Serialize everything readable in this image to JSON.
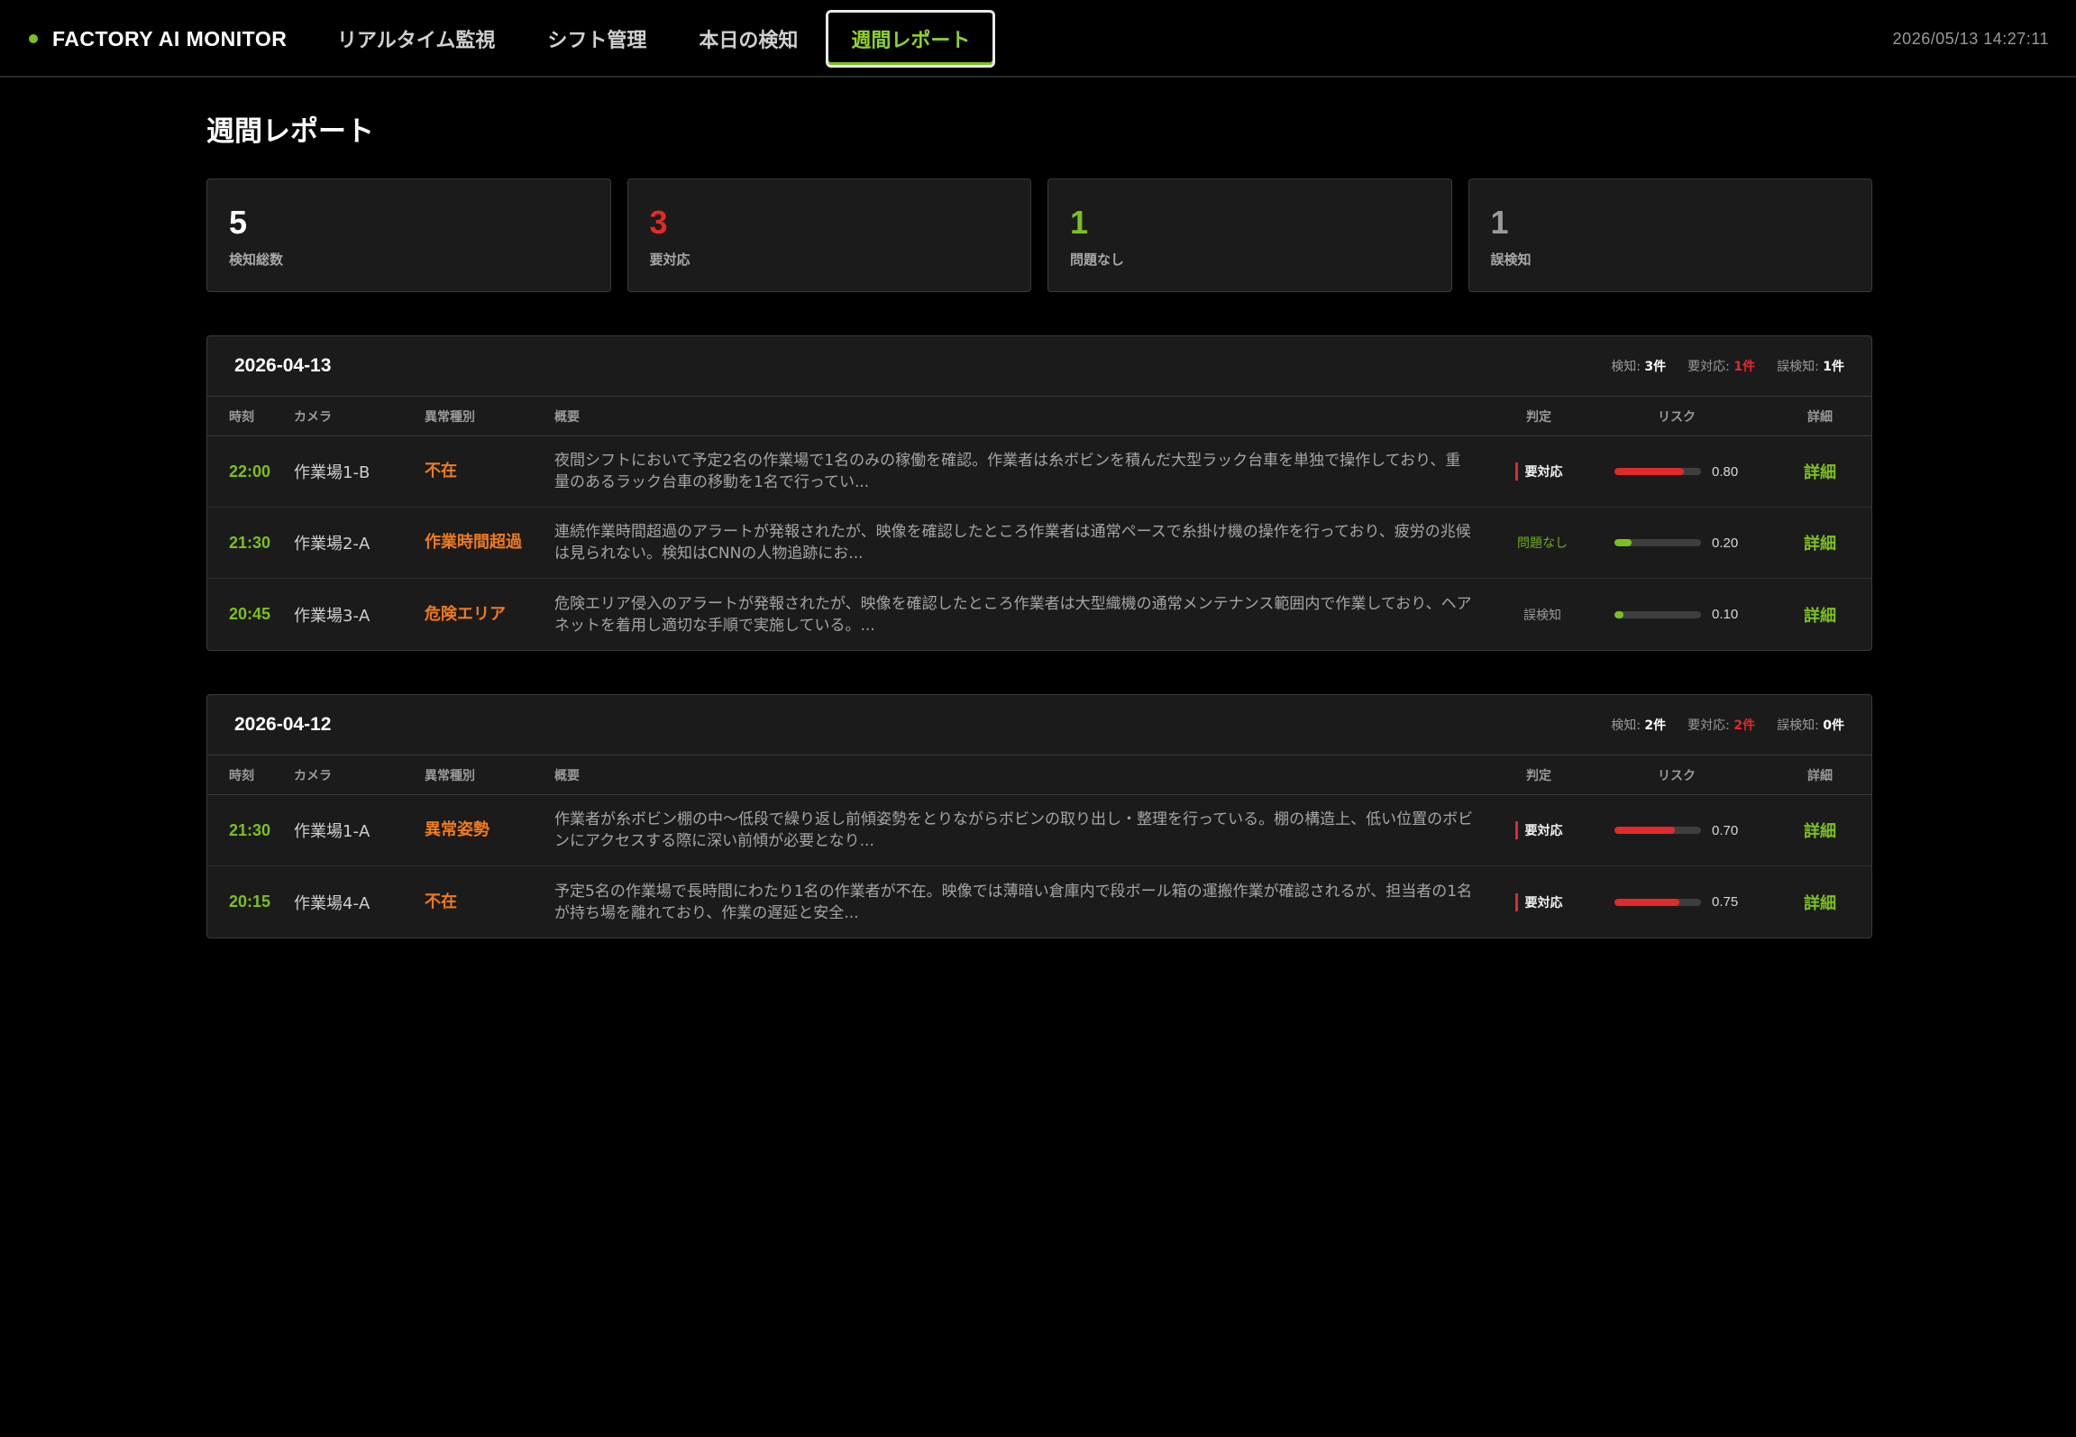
{
  "app": {
    "name": "FACTORY AI MONITOR",
    "clock": "2026/05/13 14:27:11"
  },
  "nav": {
    "tabs": [
      {
        "label": "リアルタイム監視",
        "active": false
      },
      {
        "label": "シフト管理",
        "active": false
      },
      {
        "label": "本日の検知",
        "active": false
      },
      {
        "label": "週間レポート",
        "active": true
      }
    ]
  },
  "page": {
    "title": "週間レポート"
  },
  "stats": [
    {
      "value": "5",
      "label": "検知総数",
      "color": "#ffffff"
    },
    {
      "value": "3",
      "label": "要対応",
      "color": "#e12a2a"
    },
    {
      "value": "1",
      "label": "問題なし",
      "color": "#7cc020"
    },
    {
      "value": "1",
      "label": "誤検知",
      "color": "#9a9a9a"
    }
  ],
  "columns": {
    "time": "時刻",
    "camera": "カメラ",
    "type": "異常種別",
    "summary": "概要",
    "judgement": "判定",
    "risk": "リスク",
    "detail": "詳細"
  },
  "days": [
    {
      "date": "2026-04-13",
      "counts": {
        "detect_label": "検知:",
        "detect": "3件",
        "need_label": "要対応:",
        "need": "1件",
        "false_label": "誤検知:",
        "false": "1件"
      },
      "rows": [
        {
          "time": "22:00",
          "camera": "作業場1-B",
          "type": "不在",
          "summary": "夜間シフトにおいて予定2名の作業場で1名のみの稼働を確認。作業者は糸ボビンを積んだ大型ラック台車を単独で操作しており、重量のあるラック台車の移動を1名で行ってい...",
          "judgement": "要対応",
          "judge_kind": "need",
          "risk": 0.8,
          "risk_text": "0.80",
          "risk_color": "#e12a2a",
          "detail": "詳細"
        },
        {
          "time": "21:30",
          "camera": "作業場2-A",
          "type": "作業時間超過",
          "summary": "連続作業時間超過のアラートが発報されたが、映像を確認したところ作業者は通常ペースで糸掛け機の操作を行っており、疲労の兆候は見られない。検知はCNNの人物追跡にお...",
          "judgement": "問題なし",
          "judge_kind": "ok",
          "risk": 0.2,
          "risk_text": "0.20",
          "risk_color": "#7cc020",
          "detail": "詳細"
        },
        {
          "time": "20:45",
          "camera": "作業場3-A",
          "type": "危険エリア",
          "summary": "危険エリア侵入のアラートが発報されたが、映像を確認したところ作業者は大型織機の通常メンテナンス範囲内で作業しており、ヘアネットを着用し適切な手順で実施している。...",
          "judgement": "誤検知",
          "judge_kind": "false",
          "risk": 0.1,
          "risk_text": "0.10",
          "risk_color": "#7cc020",
          "detail": "詳細"
        }
      ]
    },
    {
      "date": "2026-04-12",
      "counts": {
        "detect_label": "検知:",
        "detect": "2件",
        "need_label": "要対応:",
        "need": "2件",
        "false_label": "誤検知:",
        "false": "0件"
      },
      "rows": [
        {
          "time": "21:30",
          "camera": "作業場1-A",
          "type": "異常姿勢",
          "summary": "作業者が糸ボビン棚の中〜低段で繰り返し前傾姿勢をとりながらボビンの取り出し・整理を行っている。棚の構造上、低い位置のボビンにアクセスする際に深い前傾が必要となり...",
          "judgement": "要対応",
          "judge_kind": "need",
          "risk": 0.7,
          "risk_text": "0.70",
          "risk_color": "#e12a2a",
          "detail": "詳細"
        },
        {
          "time": "20:15",
          "camera": "作業場4-A",
          "type": "不在",
          "summary": "予定5名の作業場で長時間にわたり1名の作業者が不在。映像では薄暗い倉庫内で段ボール箱の運搬作業が確認されるが、担当者の1名が持ち場を離れており、作業の遅延と安全...",
          "judgement": "要対応",
          "judge_kind": "need",
          "risk": 0.75,
          "risk_text": "0.75",
          "risk_color": "#e12a2a",
          "detail": "詳細"
        }
      ]
    }
  ]
}
